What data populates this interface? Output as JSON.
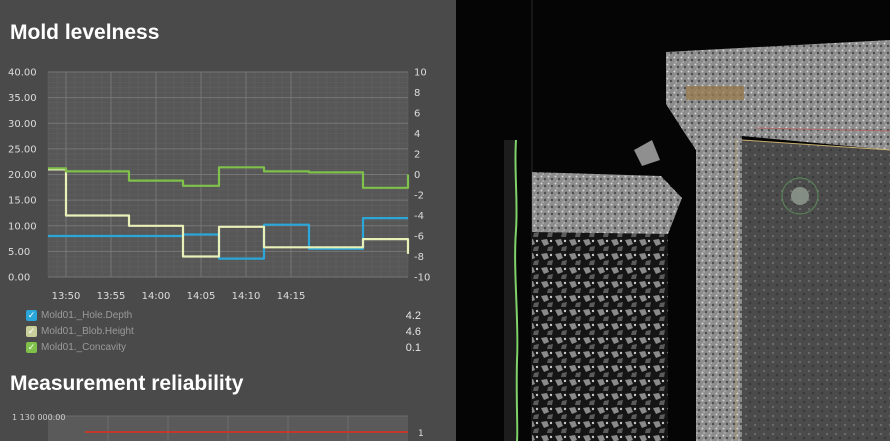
{
  "mold_levelness": {
    "title": "Mold levelness",
    "legend": [
      {
        "name": "Mold01._Hole.Depth",
        "value": "4.2",
        "color": "#2ba6d9"
      },
      {
        "name": "Mold01._Blob.Height",
        "value": "4.6",
        "color": "#e9f0b8"
      },
      {
        "name": "Mold01._Concavity",
        "value": "0.1",
        "color": "#7fc14a"
      }
    ]
  },
  "measurement_reliability": {
    "title": "Measurement reliability",
    "y_label_left": "1 130 000.00",
    "y_label_right": "1"
  },
  "chart_data": {
    "type": "line",
    "x_ticks": [
      "13:50",
      "13:55",
      "14:00",
      "14:05",
      "14:10",
      "14:15"
    ],
    "y_left_ticks": [
      "40.00",
      "35.00",
      "30.00",
      "25.00",
      "20.00",
      "15.00",
      "10.00",
      "5.00",
      "0.00"
    ],
    "y_right_ticks": [
      "10",
      "8",
      "6",
      "4",
      "2",
      "0",
      "-2",
      "-4",
      "-6",
      "-8",
      "-10"
    ],
    "ylim_left": [
      0,
      40
    ],
    "ylim_right": [
      -10,
      10
    ],
    "xlim": [
      -2,
      38
    ],
    "grid": true,
    "series": [
      {
        "name": "Mold01._Hole.Depth",
        "axis": "left",
        "color": "#2ba6d9",
        "x": [
          -2,
          7,
          7,
          13,
          13,
          17,
          17,
          22,
          22,
          27,
          27,
          33,
          33,
          38
        ],
        "y": [
          8,
          8,
          8,
          8,
          8.3,
          8.3,
          3.6,
          3.6,
          10.2,
          10.2,
          5.5,
          5.5,
          11.5,
          11.5
        ]
      },
      {
        "name": "Mold01._Blob.Height",
        "axis": "left",
        "color": "#e9f0b8",
        "x": [
          -2,
          0,
          0,
          7,
          7,
          13,
          13,
          17,
          17,
          22,
          22,
          27,
          27,
          33,
          33,
          38,
          38
        ],
        "y": [
          21,
          21,
          12,
          12,
          10,
          10,
          4,
          4,
          9.8,
          9.8,
          5.8,
          5.8,
          5.8,
          5.8,
          7.4,
          7.4,
          4.5
        ]
      },
      {
        "name": "Mold01._Concavity",
        "axis": "right",
        "color": "#7fc14a",
        "x": [
          -2,
          0,
          0,
          7,
          7,
          13,
          13,
          17,
          17,
          22,
          22,
          27,
          27,
          33,
          33,
          38,
          38
        ],
        "y": [
          0.6,
          0.6,
          0.3,
          0.3,
          -0.6,
          -0.6,
          -1.1,
          -1.1,
          0.7,
          0.7,
          0.3,
          0.3,
          0.2,
          0.2,
          -1.3,
          -1.3,
          0
        ]
      }
    ]
  },
  "viewer": {
    "background": "#050505"
  }
}
